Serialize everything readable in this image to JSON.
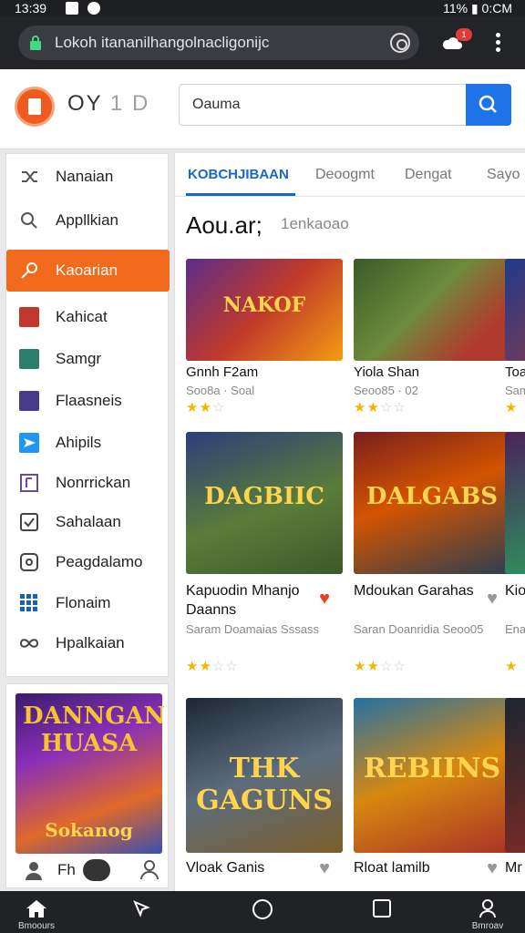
{
  "status_bar": {
    "time": "13:39",
    "right": "11% ▮ 0:CM"
  },
  "browser": {
    "url": "Lokoh itananilhangolnacligonijc",
    "tab_badge": "1"
  },
  "header": {
    "brand_primary": "OY",
    "brand_grey": "1 D",
    "search_value": "Oauma"
  },
  "sidebar": {
    "items": [
      {
        "label": "Nanaian",
        "icon": "shuffle-icon"
      },
      {
        "label": "Appllkian",
        "icon": "search-icon"
      },
      {
        "label": "Kaoarian",
        "icon": "key-icon",
        "active": true
      },
      {
        "label": "Kahicat",
        "icon": "game-icon"
      },
      {
        "label": "Samgr",
        "icon": "game-icon"
      },
      {
        "label": "Flaasneis",
        "icon": "game-icon"
      },
      {
        "label": "Ahipils",
        "icon": "send-icon"
      },
      {
        "label": "Nonrrickan",
        "icon": "book-icon"
      },
      {
        "label": "Sahalaan",
        "icon": "check-icon"
      },
      {
        "label": "Peagdalamo",
        "icon": "tag-icon"
      },
      {
        "label": "Flonaim",
        "icon": "grid-icon"
      },
      {
        "label": "Hpalkaian",
        "icon": "infinity-icon"
      }
    ]
  },
  "promo": {
    "title": "DANNGAN HUASA",
    "subtitle": "Sokanog",
    "footer_label": "Fh"
  },
  "main": {
    "tabs": [
      "KOBCHJIBAAN",
      "Deoogmt",
      "Dengat",
      "Sayo"
    ],
    "section_title": "Aou.ar;",
    "section_subtitle": "1enkaoao",
    "row1": [
      {
        "name": "Gnnh F2am",
        "meta": "Soo8a · Soal",
        "rating": 2,
        "thumb_text": "NAKOF"
      },
      {
        "name": "Yiola Shan",
        "meta": "Seoo85 · 02",
        "rating": 2,
        "thumb_text": ""
      },
      {
        "name": "Toa",
        "meta": "Sam",
        "rating": 1,
        "thumb_text": ""
      }
    ],
    "row2": [
      {
        "name": "Kapuodin Mhanjo Daanns",
        "meta": "Saram Doamaias Sssass",
        "rating": 2,
        "thumb_text": "DAGBIIC",
        "heart": "filled"
      },
      {
        "name": "Mdoukan Garahas",
        "meta": "Saran Doanridia Seoo05",
        "rating": 2,
        "thumb_text": "DALGABS",
        "heart": "outline"
      },
      {
        "name": "Kio Toa",
        "meta": "Ena",
        "rating": 1,
        "thumb_text": ""
      }
    ],
    "row3": [
      {
        "name": "Vloak Ganis",
        "thumb_text": "THK GAGUNS",
        "heart": "outline"
      },
      {
        "name": "Rloat lamilb",
        "thumb_text": "REBIINS",
        "heart": "outline"
      },
      {
        "name": "Mr",
        "thumb_text": ""
      }
    ]
  },
  "bottom_nav": [
    {
      "label": "Bmoours",
      "icon": "home-icon"
    },
    {
      "label": "",
      "icon": "back-icon"
    },
    {
      "label": "",
      "icon": "circle-home-icon"
    },
    {
      "label": "",
      "icon": "square-recents-icon"
    },
    {
      "label": "Bmroav",
      "icon": "profile-icon"
    }
  ]
}
